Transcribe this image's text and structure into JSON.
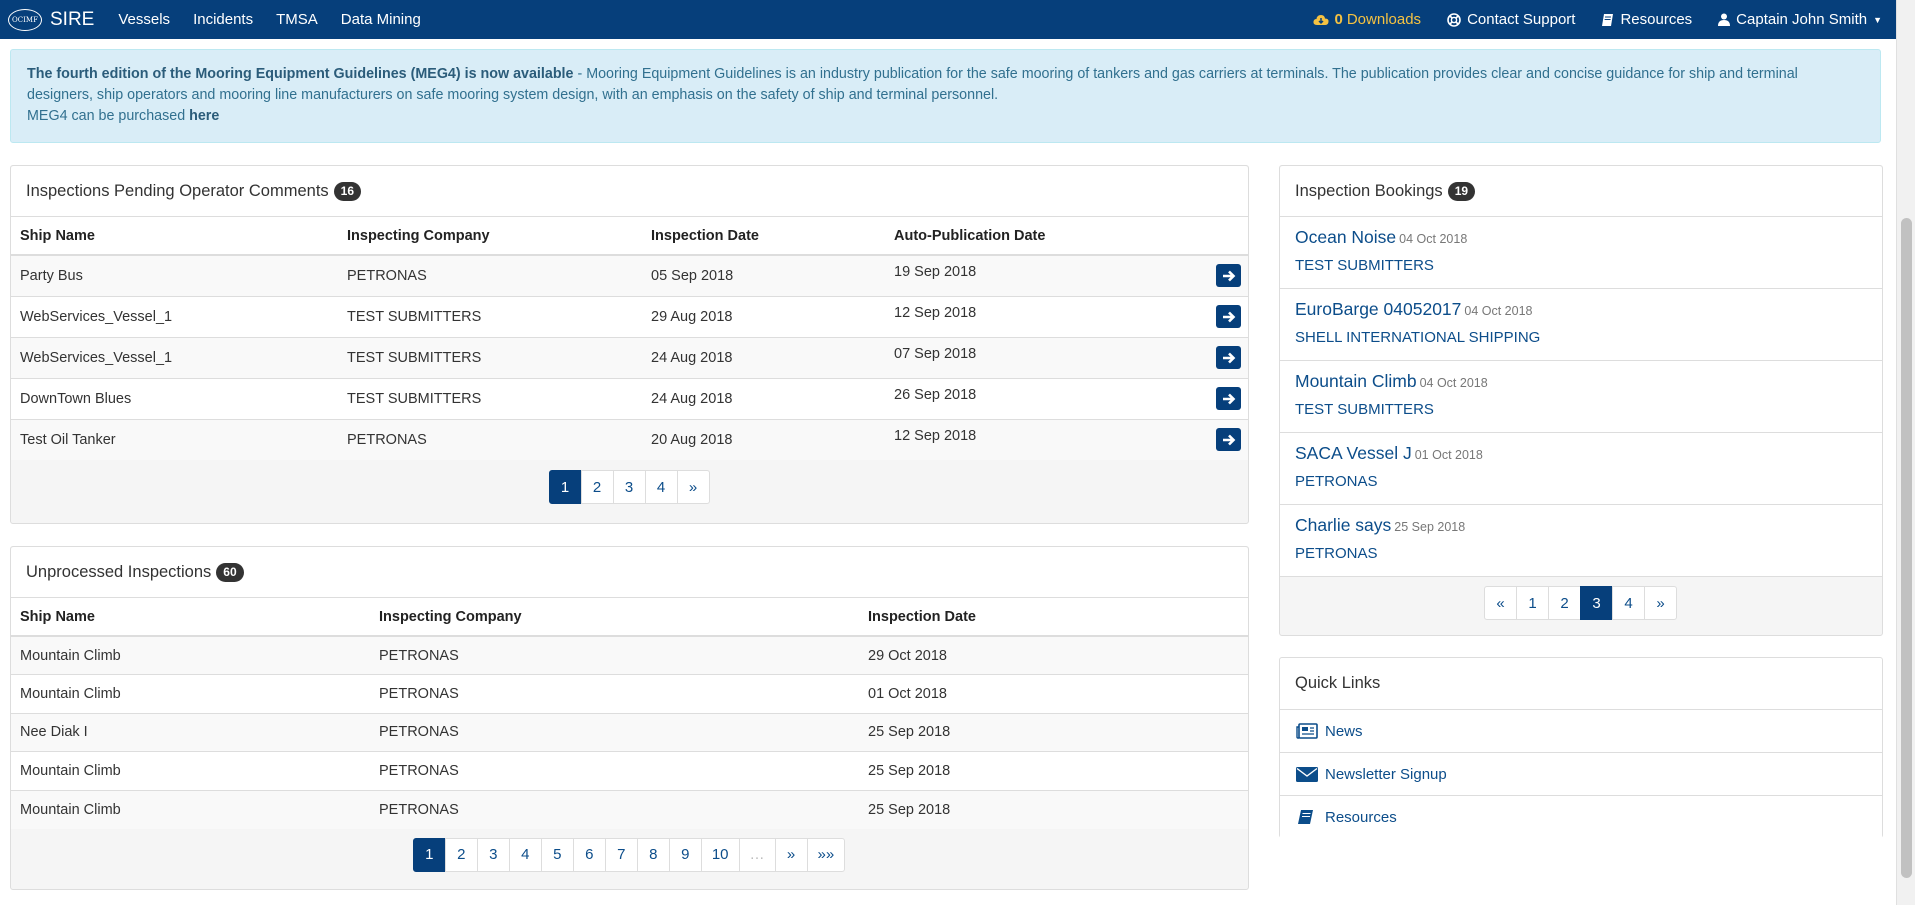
{
  "nav": {
    "brand_logo": "OCIMF",
    "brand": "SIRE",
    "items": [
      "Vessels",
      "Incidents",
      "TMSA",
      "Data Mining"
    ],
    "downloads_count": "0",
    "downloads_label": "Downloads",
    "support": "Contact Support",
    "resources": "Resources",
    "user": "Captain John Smith"
  },
  "alert": {
    "bold": "The fourth edition of the Mooring Equipment Guidelines (MEG4) is now available",
    "text": " - Mooring Equipment Guidelines is an industry publication for the safe mooring of tankers and gas carriers at terminals. The publication provides clear and concise guidance for ship and terminal designers, ship operators and mooring line manufacturers on safe mooring system design, with an emphasis on the safety of ship and terminal personnel.",
    "purchase_text": "MEG4 can be purchased ",
    "purchase_link": "here"
  },
  "pending": {
    "title": "Inspections Pending Operator Comments",
    "count": "16",
    "headers": [
      "Ship Name",
      "Inspecting Company",
      "Inspection Date",
      "Auto-Publication Date"
    ],
    "rows": [
      [
        "Party Bus",
        "PETRONAS",
        "05 Sep 2018",
        "19 Sep 2018"
      ],
      [
        "WebServices_Vessel_1",
        "TEST SUBMITTERS",
        "29 Aug 2018",
        "12 Sep 2018"
      ],
      [
        "WebServices_Vessel_1",
        "TEST SUBMITTERS",
        "24 Aug 2018",
        "07 Sep 2018"
      ],
      [
        "DownTown Blues",
        "TEST SUBMITTERS",
        "24 Aug 2018",
        "26 Sep 2018"
      ],
      [
        "Test Oil Tanker",
        "PETRONAS",
        "20 Aug 2018",
        "12 Sep 2018"
      ]
    ],
    "pages": [
      "1",
      "2",
      "3",
      "4",
      "»"
    ],
    "active_page": "1"
  },
  "unprocessed": {
    "title": "Unprocessed Inspections",
    "count": "60",
    "headers": [
      "Ship Name",
      "Inspecting Company",
      "Inspection Date"
    ],
    "rows": [
      [
        "Mountain Climb",
        "PETRONAS",
        "29 Oct 2018"
      ],
      [
        "Mountain Climb",
        "PETRONAS",
        "01 Oct 2018"
      ],
      [
        "Nee Diak I",
        "PETRONAS",
        "25 Sep 2018"
      ],
      [
        "Mountain Climb",
        "PETRONAS",
        "25 Sep 2018"
      ],
      [
        "Mountain Climb",
        "PETRONAS",
        "25 Sep 2018"
      ]
    ],
    "pages": [
      "1",
      "2",
      "3",
      "4",
      "5",
      "6",
      "7",
      "8",
      "9",
      "10",
      "…",
      "»",
      "»»"
    ],
    "active_page": "1"
  },
  "bookings": {
    "title": "Inspection Bookings",
    "count": "19",
    "items": [
      {
        "name": "Ocean Noise",
        "date": "04 Oct 2018",
        "company": "TEST SUBMITTERS"
      },
      {
        "name": "EuroBarge 04052017",
        "date": "04 Oct 2018",
        "company": "SHELL INTERNATIONAL SHIPPING"
      },
      {
        "name": "Mountain Climb",
        "date": "04 Oct 2018",
        "company": "TEST SUBMITTERS"
      },
      {
        "name": "SACA Vessel J",
        "date": "01 Oct 2018",
        "company": "PETRONAS"
      },
      {
        "name": "Charlie says",
        "date": "25 Sep 2018",
        "company": "PETRONAS"
      }
    ],
    "pages": [
      "«",
      "1",
      "2",
      "3",
      "4",
      "»"
    ],
    "active_page": "3"
  },
  "quick_links": {
    "title": "Quick Links",
    "items": [
      {
        "label": "News",
        "icon": "newspaper-icon"
      },
      {
        "label": "Newsletter Signup",
        "icon": "envelope-icon"
      },
      {
        "label": "Resources",
        "icon": "book-icon"
      }
    ]
  },
  "colors": {
    "navbar": "#063f7b",
    "link": "#0c4d8a",
    "alert_bg": "#d9edf7",
    "downloads": "#f5c242"
  }
}
